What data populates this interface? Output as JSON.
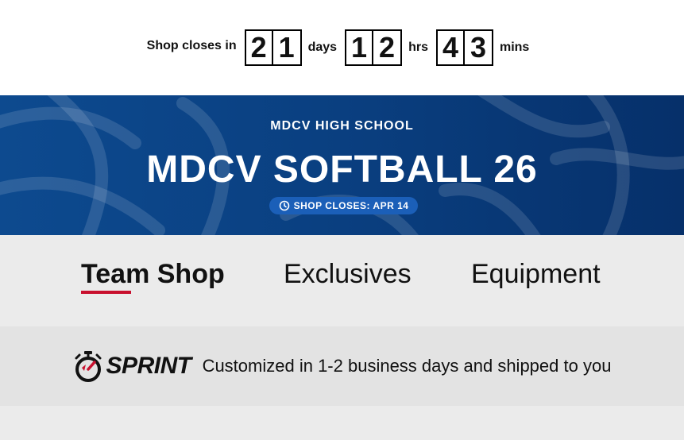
{
  "countdown": {
    "label": "Shop closes in",
    "days_digits": [
      "2",
      "1"
    ],
    "days_unit": "days",
    "hours_digits": [
      "1",
      "2"
    ],
    "hours_unit": "hrs",
    "mins_digits": [
      "4",
      "3"
    ],
    "mins_unit": "mins"
  },
  "hero": {
    "school": "MDCV HIGH SCHOOL",
    "title": "MDCV SOFTBALL 26",
    "badge": "SHOP CLOSES: APR 14"
  },
  "tabs": [
    {
      "label": "Team Shop",
      "active": true
    },
    {
      "label": "Exclusives",
      "active": false
    },
    {
      "label": "Equipment",
      "active": false
    }
  ],
  "sprint": {
    "logo_text": "SPRINT",
    "message": "Customized in 1-2 business days and shipped to you",
    "logo_icon": "stopwatch-icon"
  },
  "colors": {
    "hero_bg": "#0a3f80",
    "badge_bg": "#1b5fb8",
    "accent_red": "#c8102e",
    "tabs_bg": "#ebebeb",
    "sprint_bg": "#e3e3e3"
  }
}
